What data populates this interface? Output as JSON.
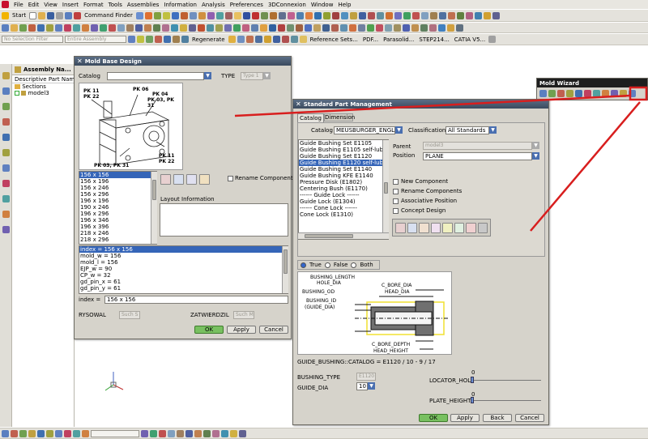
{
  "menubar": {
    "items": [
      "File",
      "Edit",
      "View",
      "Insert",
      "Format",
      "Tools",
      "Assemblies",
      "Information",
      "Analysis",
      "Preferences",
      "3DConnexion",
      "Window",
      "Help"
    ]
  },
  "toolbar1": {
    "start_label": "Start",
    "command_finder": "Command Finder"
  },
  "toolbar2": {
    "selection_filter": "No Selection Filter",
    "assembly_scope": "Entire Assembly",
    "regenerate": "Regenerate",
    "reference_sets": "Reference Sets...",
    "pdf": "PDF...",
    "parasolid": "Parasolid...",
    "step214": "STEP214...",
    "catia": "CATIA V5..."
  },
  "navigator": {
    "title": "Assembly Na...",
    "column": "Descriptive Part Name",
    "items": [
      {
        "label": "Sections"
      },
      {
        "label": "model3"
      }
    ]
  },
  "mold_wizard": {
    "title": "Mold Wizard"
  },
  "mold_base": {
    "title": "Mold Base Design",
    "catalog_label": "Catalog",
    "type_label": "TYPE",
    "type_value": "Type 1",
    "picture_labels": [
      "PK 11",
      "PK 22",
      "PK 06",
      "PK 04",
      "PK 03, PK 31",
      "PK 03, PK 31",
      "PK 11",
      "PK 22"
    ],
    "sizes": [
      "156 x 156",
      "156 x 196",
      "156 x 246",
      "156 x 296",
      "196 x 196",
      "190 x 246",
      "196 x 296",
      "196 x 346",
      "196 x 396",
      "218 x 246",
      "218 x 296"
    ],
    "rename_components": "Rename Components",
    "layout_information": "Layout Information",
    "expressions": [
      "index = 156 x 156",
      "mold_w = 156",
      "mold_l = 156",
      "EJP_w = 90",
      "CP_w = 32",
      "gd_pin_x = 61",
      "gd_pin_y = 61"
    ],
    "index_label": "index =",
    "index_value": "156 x 156",
    "rysowal_label": "RYSOWAL",
    "rysowal_value": "Such S",
    "zatwierdzil_label": "ZATWIERDZIL",
    "zatwierdzil_value": "Such M",
    "ok": "OK",
    "apply": "Apply",
    "cancel": "Cancel"
  },
  "standard_part": {
    "title": "Standard Part Management",
    "tabs": [
      "Catalog",
      "Dimension"
    ],
    "catalog_label": "Catalog",
    "catalog_value": "MEUSBURGER_ENGLISH",
    "classification_label": "Classification",
    "classification_value": "All Standards",
    "parts": [
      "Guide Bushing Set E1105",
      "Guide Bushing E1105 self-lubricat",
      "Guide Bushing Set E1120",
      "Guide Bushing E1120 self-lubricat",
      "Guide Bushing Set E1140",
      "Guide Bushing KFE E1140",
      "Pressure Disk (E1802)",
      "Centering Bush (E1170)",
      "------ Guide Lock ------",
      "Guide Lock (E1304)",
      "------ Cone Lock ------",
      "Cone Lock (E1310)"
    ],
    "parent_label": "Parent",
    "parent_value": "model3",
    "position_label": "Position",
    "position_value": "PLANE",
    "new_component": "New Component",
    "rename_components": "Rename Components",
    "associative_position": "Associative Position",
    "concept_design": "Concept Design",
    "radio": [
      "True",
      "False",
      "Both"
    ],
    "diagram_labels": [
      "BUSHING_LENGTH",
      "HOLE_DIA",
      "BUSHING_OD",
      "BUSHING_ID",
      "(GUIDE_DIA)",
      "C_BORE_DIA",
      "HEAD_DIA",
      "C_BORE_DEPTH",
      "HEAD_HEIGHT"
    ],
    "catalog_string": "GUIDE_BUSHING::CATALOG = E1120 / 10 - 9 / 17",
    "bushing_type_label": "BUSHING_TYPE",
    "bushing_type_value": "E1120",
    "guide_dia_label": "GUIDE_DIA",
    "guide_dia_value": "10",
    "locator_hole_label": "LOCATOR_HOLE",
    "locator_hole_value": "0",
    "plate_height_label": "PLATE_HEIGHT",
    "plate_height_value": "0",
    "ok": "OK",
    "apply": "Apply",
    "back": "Back",
    "cancel": "Cancel"
  },
  "colors": {
    "annotation_red": "#d81e1e",
    "selection_blue": "#3565b8",
    "ok_green": "#78c060"
  }
}
